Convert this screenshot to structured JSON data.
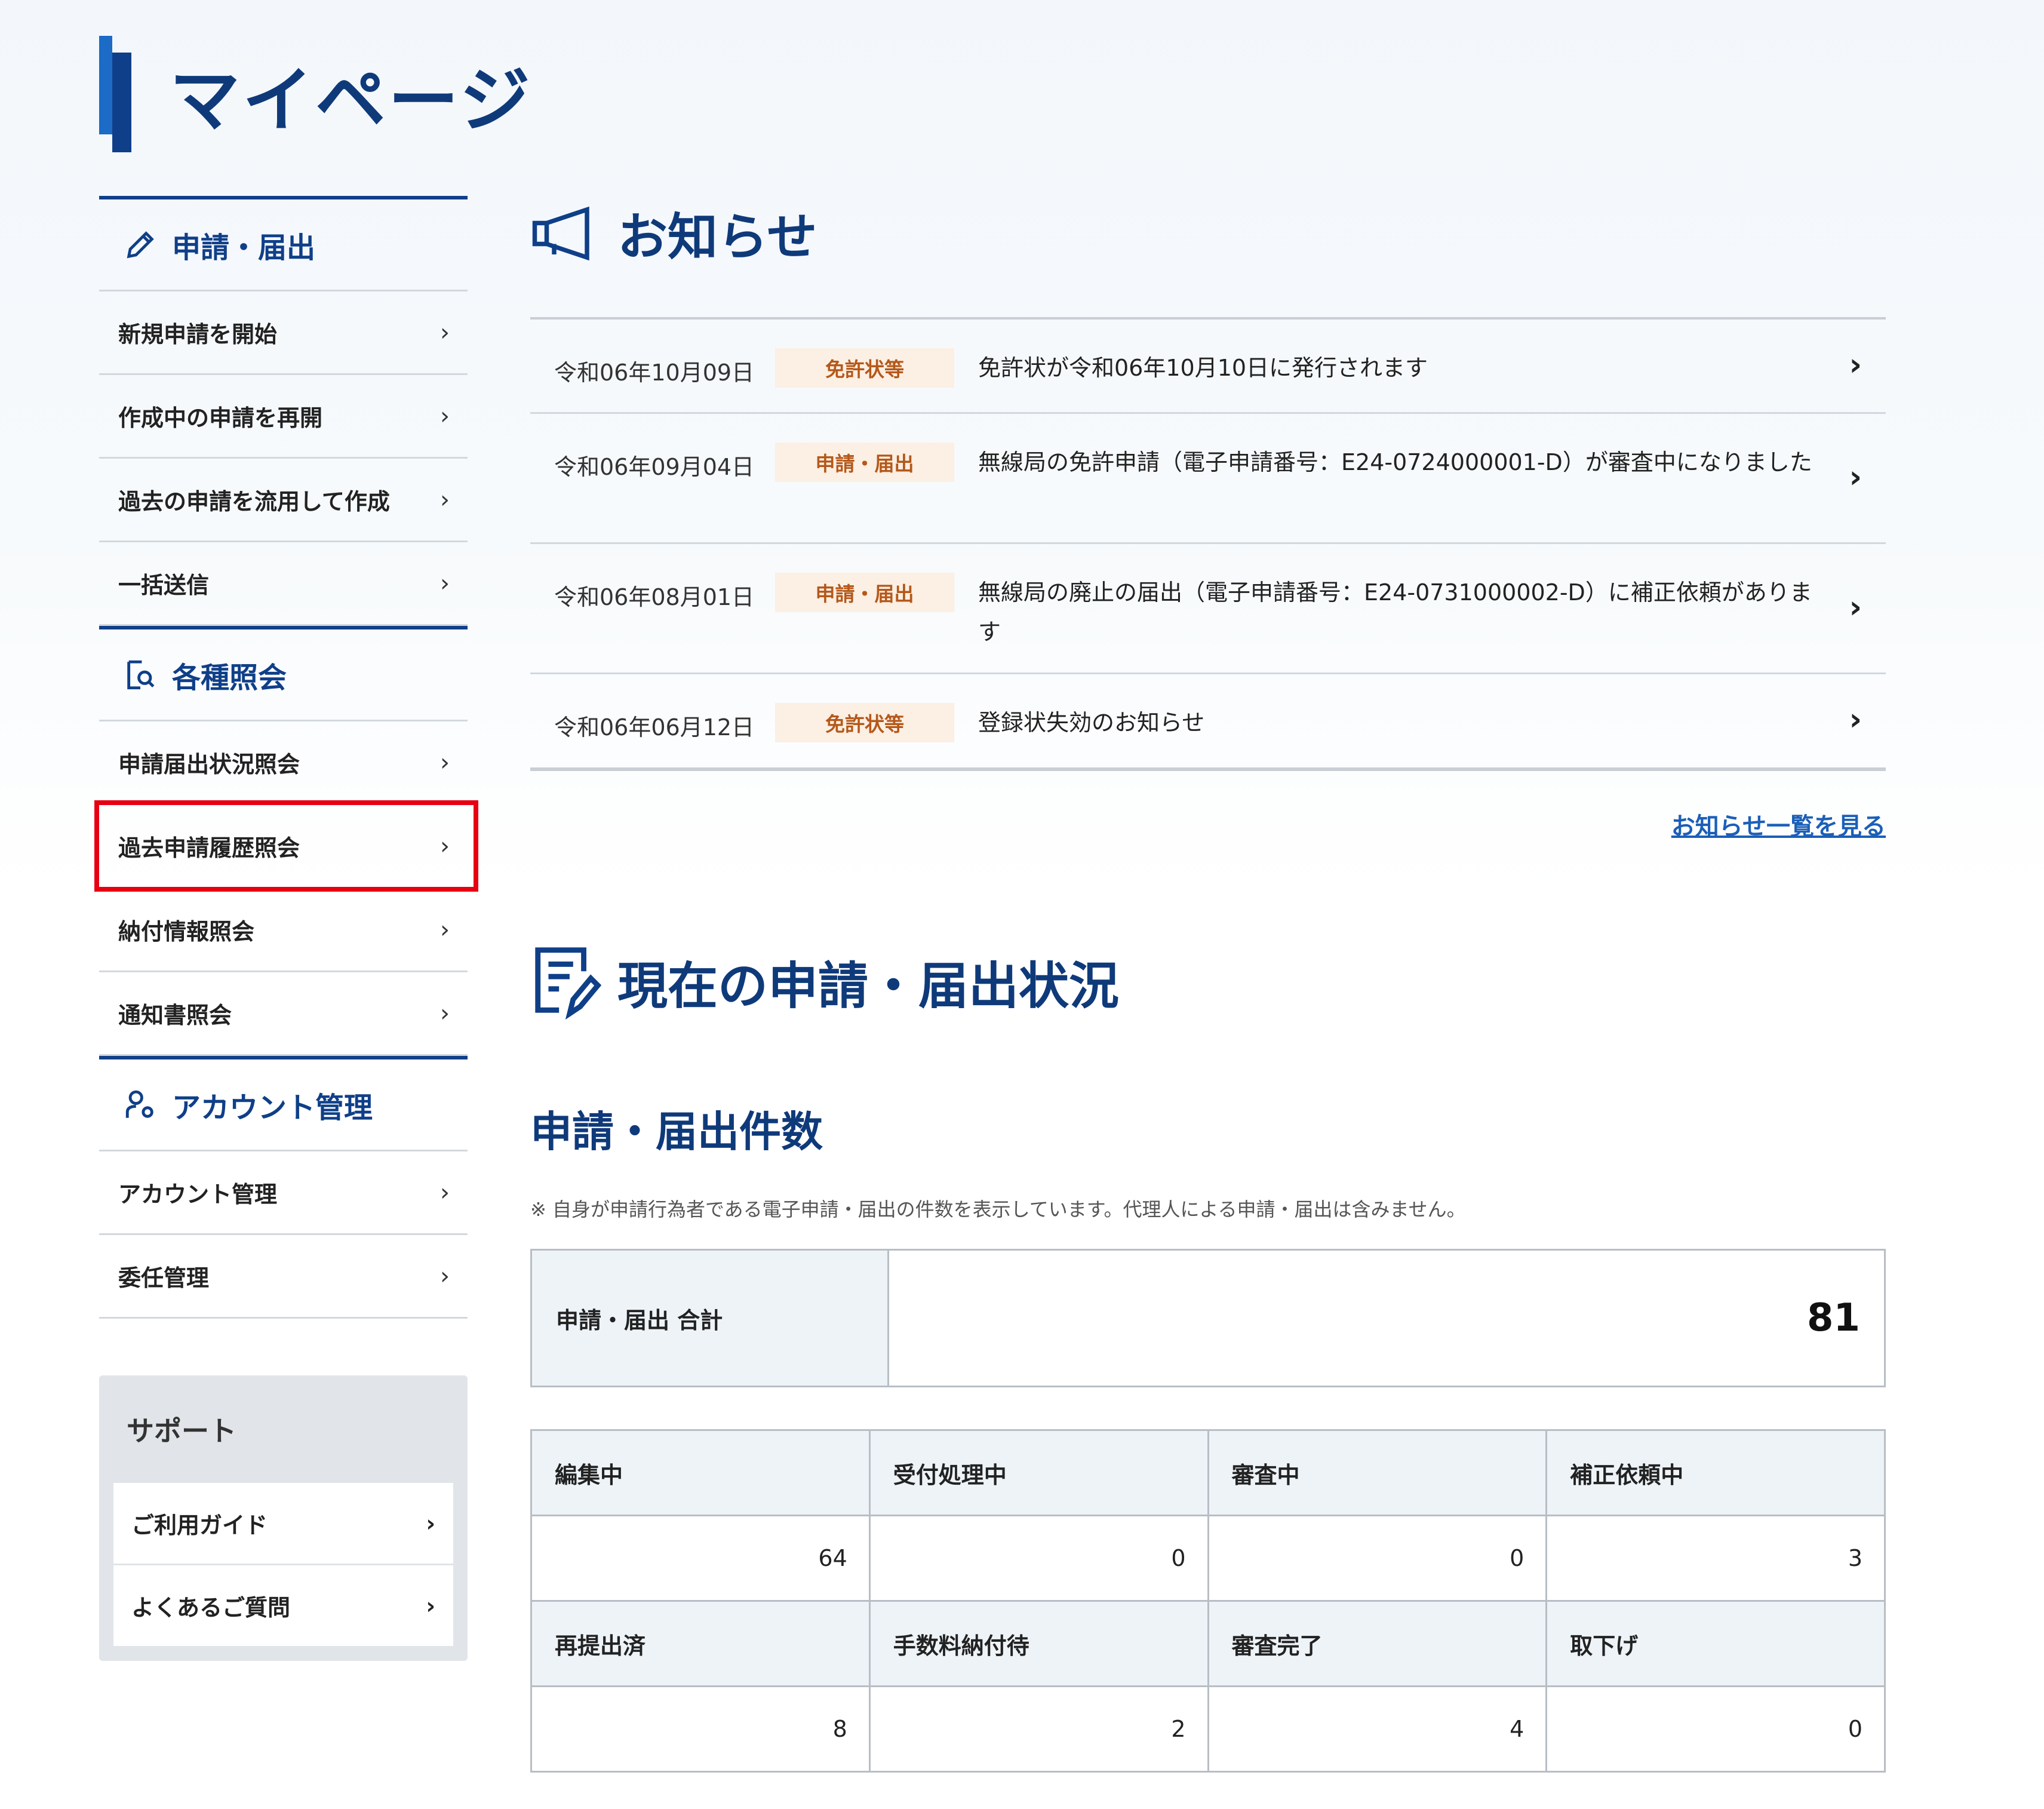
{
  "page": {
    "title": "マイページ"
  },
  "sidebar": {
    "sections": [
      {
        "title": "申請・届出",
        "icon": "pencil-icon",
        "items": [
          "新規申請を開始",
          "作成中の申請を再開",
          "過去の申請を流用して作成",
          "一括送信"
        ]
      },
      {
        "title": "各種照会",
        "icon": "document-search-icon",
        "items": [
          "申請届出状況照会",
          "過去申請履歴照会",
          "納付情報照会",
          "通知書照会"
        ],
        "highlighted_item": "過去申請履歴照会"
      },
      {
        "title": "アカウント管理",
        "icon": "user-settings-icon",
        "items": [
          "アカウント管理",
          "委任管理"
        ]
      }
    ],
    "support": {
      "title": "サポート",
      "items": [
        "ご利用ガイド",
        "よくあるご質問"
      ]
    },
    "chevron": "›"
  },
  "notices": {
    "title": "お知らせ",
    "icon": "megaphone-icon",
    "items": [
      {
        "date": "令和06年10月09日",
        "tag": "免許状等",
        "text": "免許状が令和06年10月10日に発行されます"
      },
      {
        "date": "令和06年09月04日",
        "tag": "申請・届出",
        "text": "無線局の免許申請（電子申請番号：E24-0724000001-D）が審査中になりました"
      },
      {
        "date": "令和06年08月01日",
        "tag": "申請・届出",
        "text": "無線局の廃止の届出（電子申請番号：E24-0731000002-D）に補正依頼があります"
      },
      {
        "date": "令和06年06月12日",
        "tag": "免許状等",
        "text": "登録状失効のお知らせ"
      }
    ],
    "arrow": "›",
    "more_link": "お知らせ一覧を見る"
  },
  "status": {
    "title": "現在の申請・届出状況",
    "icon": "document-edit-icon",
    "subtitle": "申請・届出件数",
    "note": "※ 自身が申請行為者である電子申請・届出の件数を表示しています。代理人による申請・届出は含みません。",
    "total_label": "申請・届出 合計",
    "total_value": "81",
    "counts": [
      {
        "label": "編集中",
        "value": "64"
      },
      {
        "label": "受付処理中",
        "value": "0"
      },
      {
        "label": "審査中",
        "value": "0"
      },
      {
        "label": "補正依頼中",
        "value": "3"
      },
      {
        "label": "再提出済",
        "value": "8"
      },
      {
        "label": "手数料納付待",
        "value": "2"
      },
      {
        "label": "審査完了",
        "value": "4"
      },
      {
        "label": "取下げ",
        "value": "0"
      }
    ]
  },
  "colors": {
    "primary": "#0f3f88",
    "accent": "#1b6bc7",
    "tag_bg": "#fcefe3",
    "tag_text": "#b4581a",
    "highlight": "#e60012"
  }
}
